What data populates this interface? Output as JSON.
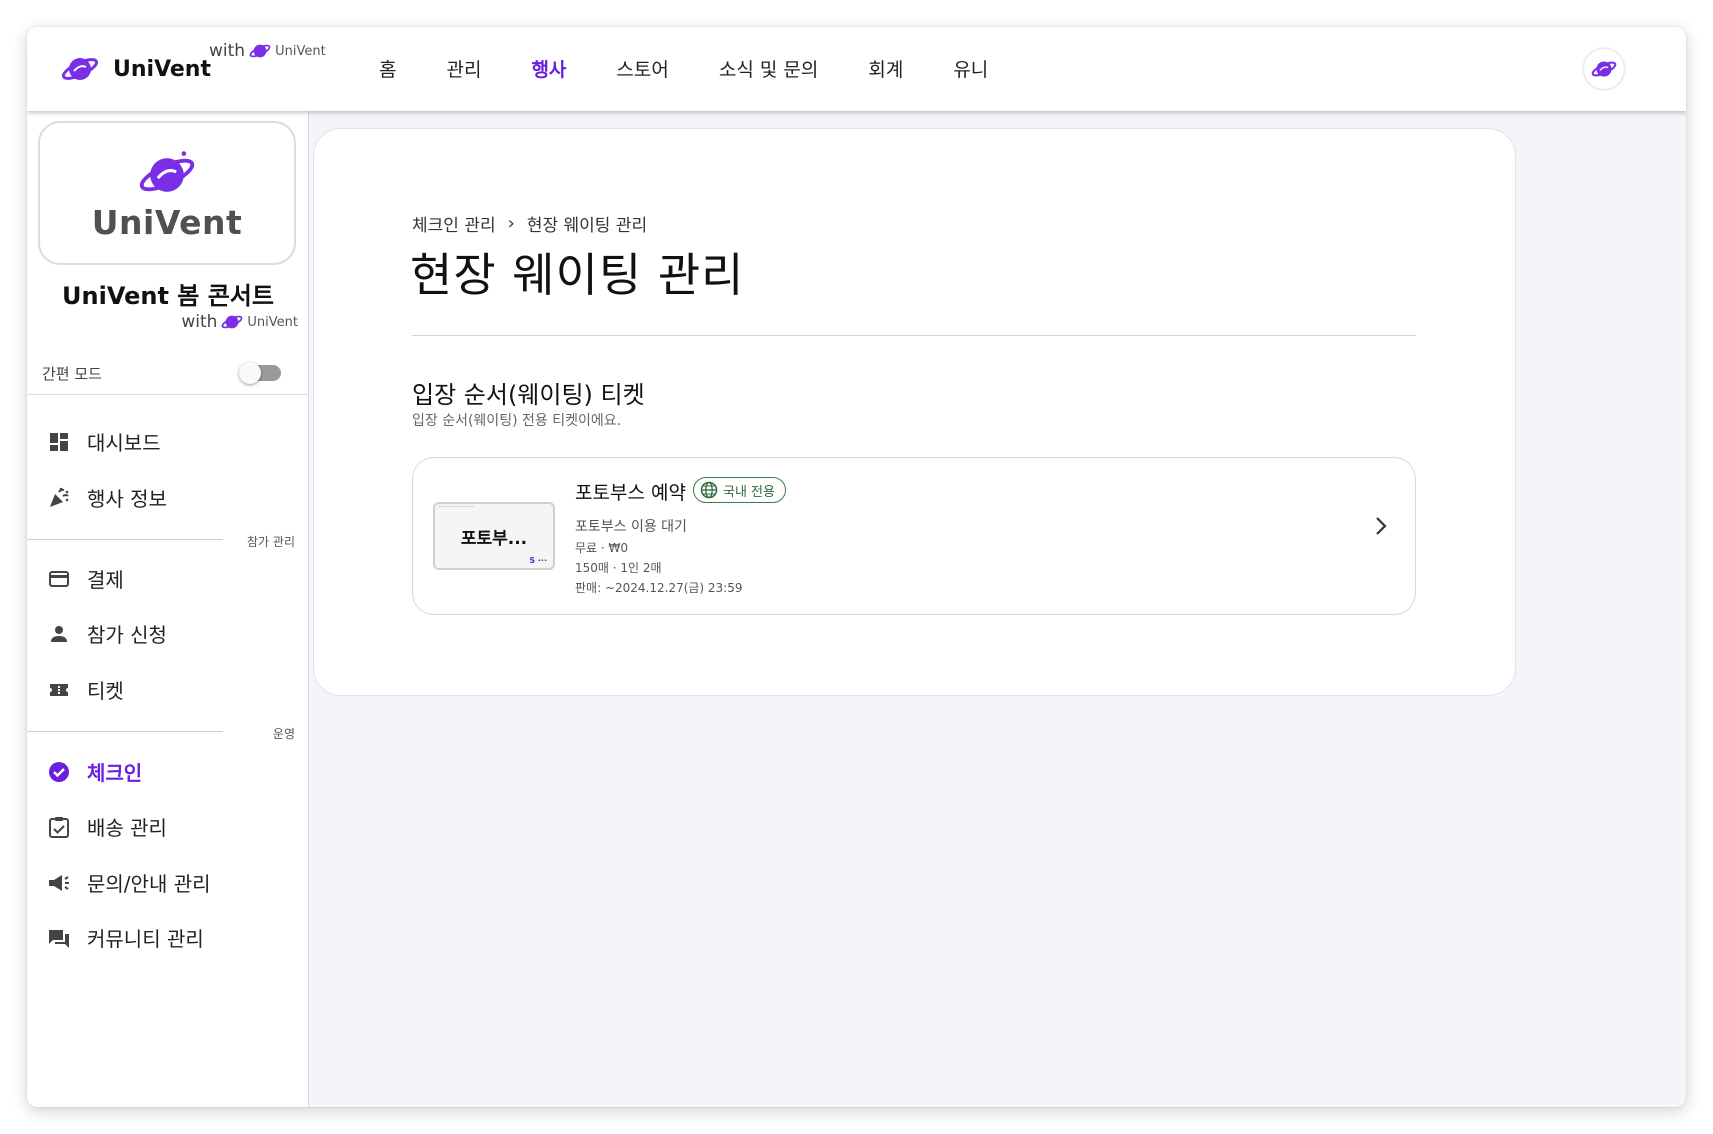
{
  "header": {
    "brand": "UniVent",
    "with_label": "with",
    "with_brand": "UniVent",
    "nav": [
      {
        "label": "홈",
        "active": false
      },
      {
        "label": "관리",
        "active": false
      },
      {
        "label": "행사",
        "active": true
      },
      {
        "label": "스토어",
        "active": false
      },
      {
        "label": "소식 및 문의",
        "active": false
      },
      {
        "label": "회계",
        "active": false
      },
      {
        "label": "유니",
        "active": false
      }
    ],
    "avatar_icon": "planet-icon"
  },
  "sidebar": {
    "logo_text": "UniVent",
    "event_title": "UniVent 봄 콘서트",
    "with_label": "with",
    "with_brand": "UniVent",
    "simple_mode_label": "간편 모드",
    "simple_mode_on": false,
    "items_top": [
      {
        "label": "대시보드",
        "icon": "dashboard-icon"
      },
      {
        "label": "행사 정보",
        "icon": "celebration-icon"
      }
    ],
    "section_participation": "참가 관리",
    "items_participation": [
      {
        "label": "결제",
        "icon": "credit-card-icon"
      },
      {
        "label": "참가 신청",
        "icon": "person-icon"
      },
      {
        "label": "티켓",
        "icon": "ticket-icon"
      }
    ],
    "section_operation": "운영",
    "items_operation": [
      {
        "label": "체크인",
        "icon": "check-circle-icon",
        "active": true
      },
      {
        "label": "배송 관리",
        "icon": "clipboard-check-icon"
      },
      {
        "label": "문의/안내 관리",
        "icon": "megaphone-icon"
      },
      {
        "label": "커뮤니티 관리",
        "icon": "forum-icon"
      }
    ]
  },
  "main": {
    "breadcrumb": [
      "체크인 관리",
      "현장 웨이팅 관리"
    ],
    "page_title": "현장 웨이팅 관리",
    "section_title": "입장 순서(웨이팅) 티켓",
    "section_subtitle": "입장 순서(웨이팅) 전용 티켓이에요.",
    "ticket": {
      "thumb_label": "포토부...",
      "name": "포토부스 예약",
      "badge": "국내 전용",
      "description": "포토부스 이용 대기",
      "price": "무료 · ₩0",
      "quantity": "150매 · 1인 2매",
      "sale_period": "판매: ~2024.12.27(금) 23:59"
    }
  },
  "colors": {
    "accent": "#6b1fe0",
    "background": "#f6f4fb",
    "badge_green": "#2f6b3c"
  }
}
